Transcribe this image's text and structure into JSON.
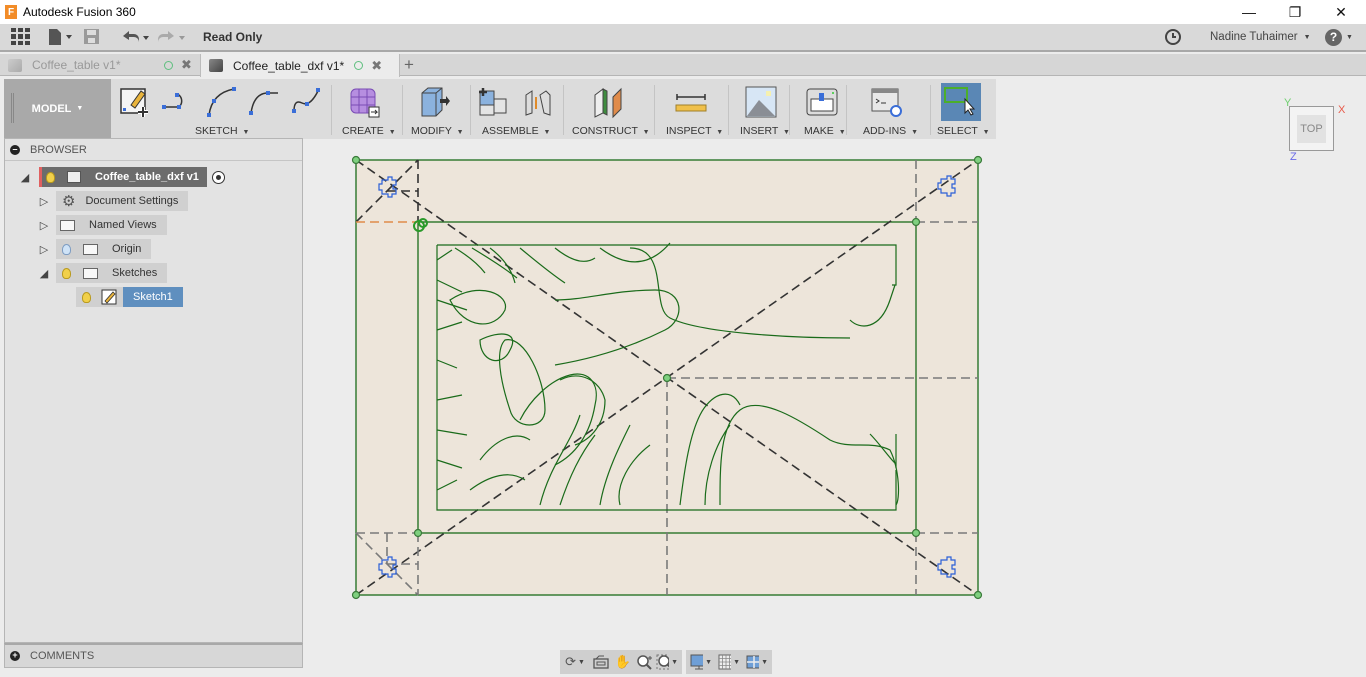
{
  "window": {
    "title": "Autodesk Fusion 360",
    "logo_letter": "F",
    "controls": [
      "minimize",
      "restore",
      "close"
    ]
  },
  "quick_access": {
    "read_only_label": "Read Only",
    "user_name": "Nadine Tuhaimer",
    "help_label": "?"
  },
  "tabs": [
    {
      "label": "Coffee_table v1*",
      "active": false
    },
    {
      "label": "Coffee_table_dxf v1*",
      "active": true
    }
  ],
  "toolbar": {
    "workspace_label": "MODEL",
    "groups": [
      {
        "label": "SKETCH"
      },
      {
        "label": "CREATE"
      },
      {
        "label": "MODIFY"
      },
      {
        "label": "ASSEMBLE"
      },
      {
        "label": "CONSTRUCT"
      },
      {
        "label": "INSPECT"
      },
      {
        "label": "INSERT"
      },
      {
        "label": "MAKE"
      },
      {
        "label": "ADD-INS"
      },
      {
        "label": "SELECT"
      }
    ]
  },
  "browser": {
    "title": "BROWSER",
    "root": {
      "label": "Coffee_table_dxf v1"
    },
    "items": [
      {
        "label": "Document Settings",
        "icon": "gear-icon",
        "expanded": false
      },
      {
        "label": "Named Views",
        "icon": "folder-icon",
        "expanded": false
      },
      {
        "label": "Origin",
        "icon": "folder-icon",
        "expanded": false,
        "visibility": "hidden"
      },
      {
        "label": "Sketches",
        "icon": "folder-icon",
        "expanded": true,
        "visibility": "visible"
      }
    ],
    "sketch": {
      "label": "Sketch1",
      "selected": true
    }
  },
  "comments": {
    "label": "COMMENTS"
  },
  "viewcube": {
    "face": "TOP",
    "axes": {
      "x": "X",
      "y": "Y",
      "z": "Z"
    }
  },
  "colors": {
    "sketch_line": "#1a6b1a",
    "construction": "#333333",
    "plane_fill": "#ede5da",
    "select_active": "#5a87b5",
    "point_fill": "#7fd07f",
    "axis_x": "#e85a4a",
    "axis_y": "#6fcf6f",
    "axis_z": "#6a6ae8"
  }
}
